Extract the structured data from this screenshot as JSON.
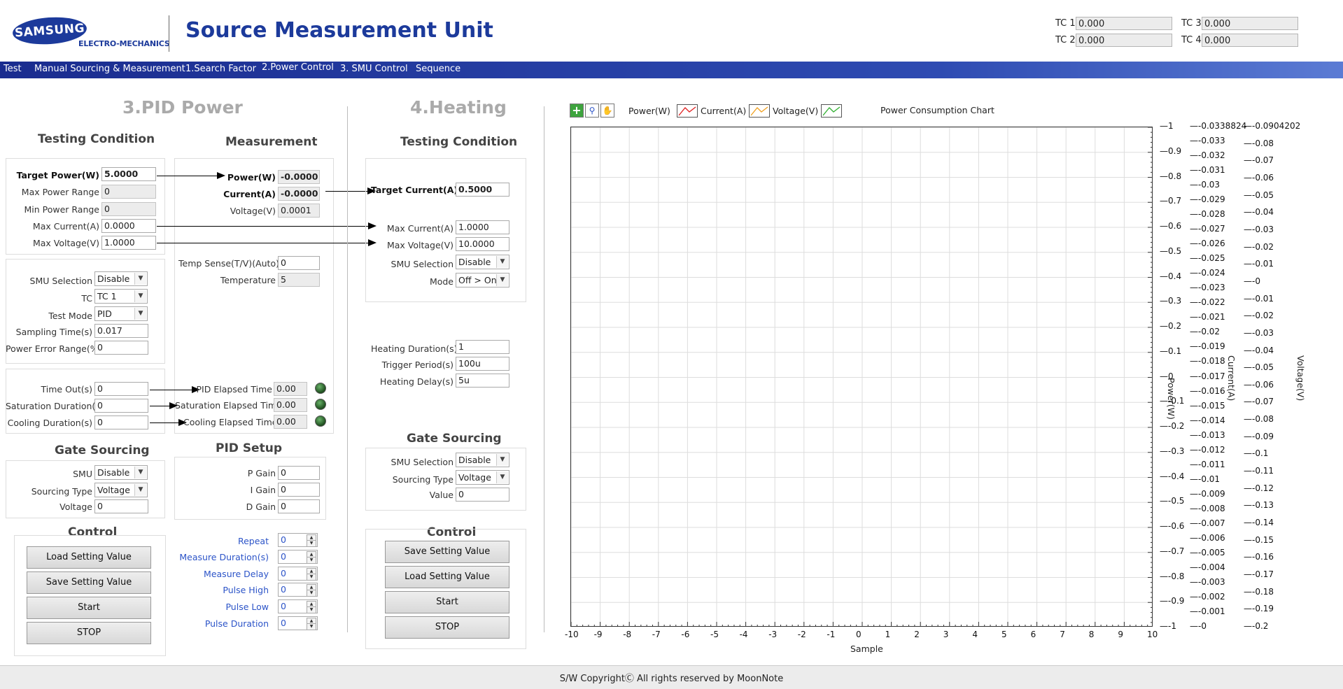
{
  "header": {
    "logo_text": "SAMSUNG",
    "logo_sub": "ELECTRO-MECHANICS",
    "title": "Source Measurement Unit",
    "tc": [
      {
        "label": "TC 1",
        "value": "0.000"
      },
      {
        "label": "TC 2",
        "value": "0.000"
      },
      {
        "label": "TC 3",
        "value": "0.000"
      },
      {
        "label": "TC 4",
        "value": "0.000"
      }
    ]
  },
  "menu": [
    "Test",
    "Manual Sourcing & Measurement",
    "1.Search Factor",
    "2.Power Control",
    "3. SMU Control",
    "Sequence"
  ],
  "pid": {
    "title": "3.PID Power",
    "testing_condition_title": "Testing Condition",
    "measurement_title": "Measurement",
    "tc_fields": [
      {
        "label": "Target Power(W)",
        "value": "5.0000"
      },
      {
        "label": "Max Power Range",
        "value": "0"
      },
      {
        "label": "Min Power Range",
        "value": "0"
      },
      {
        "label": "Max Current(A)",
        "value": "0.0000"
      },
      {
        "label": "Max Voltage(V)",
        "value": "1.0000"
      }
    ],
    "meas_fields": [
      {
        "label": "Power(W)",
        "value": "-0.0000"
      },
      {
        "label": "Current(A)",
        "value": "-0.0000"
      },
      {
        "label": "Voltage(V)",
        "value": "0.0001"
      }
    ],
    "temp_sense": {
      "label": "Temp Sense(T/V)(Auto)",
      "value": "0"
    },
    "temperature": {
      "label": "Temperature",
      "value": "5"
    },
    "smu_selection": {
      "label": "SMU Selection",
      "value": "Disable"
    },
    "tc": {
      "label": "TC",
      "value": "TC 1"
    },
    "test_mode": {
      "label": "Test Mode",
      "value": "PID"
    },
    "sampling_time": {
      "label": "Sampling Time(s)",
      "value": "0.017"
    },
    "power_error": {
      "label": "Power Error Range(%)",
      "value": "0"
    },
    "time_out": {
      "label": "Time Out(s)",
      "value": "0"
    },
    "saturation_duration": {
      "label": "Saturation Duration(s)",
      "value": "0"
    },
    "cooling_duration": {
      "label": "Cooling Duration(s)",
      "value": "0"
    },
    "pid_elapsed": {
      "label": "PID Elapsed Time",
      "value": "0.00"
    },
    "sat_elapsed": {
      "label": "Saturation Elapsed Time",
      "value": "0.00"
    },
    "cool_elapsed": {
      "label": "Cooling Elapsed Time",
      "value": "0.00"
    },
    "gate_title": "Gate Sourcing",
    "gate_smu": {
      "label": "SMU",
      "value": "Disable"
    },
    "gate_type": {
      "label": "Sourcing Type",
      "value": "Voltage"
    },
    "gate_voltage": {
      "label": "Voltage",
      "value": "0"
    },
    "pid_setup_title": "PID Setup",
    "p_gain": {
      "label": "P Gain",
      "value": "0"
    },
    "i_gain": {
      "label": "I Gain",
      "value": "0"
    },
    "d_gain": {
      "label": "D Gain",
      "value": "0"
    },
    "control_title": "Control",
    "buttons": [
      "Load Setting Value",
      "Save Setting Value",
      "Start",
      "STOP"
    ],
    "pulse": [
      {
        "label": "Repeat",
        "value": "0"
      },
      {
        "label": "Measure Duration(s)",
        "value": "0"
      },
      {
        "label": "Measure Delay",
        "value": "0"
      },
      {
        "label": "Pulse High",
        "value": "0"
      },
      {
        "label": "Pulse Low",
        "value": "0"
      },
      {
        "label": "Pulse Duration",
        "value": "0"
      }
    ]
  },
  "heating": {
    "title": "4.Heating",
    "testing_condition_title": "Testing Condition",
    "target_current": {
      "label": "Target Current(A)",
      "value": "0.5000"
    },
    "max_current": {
      "label": "Max Current(A)",
      "value": "1.0000"
    },
    "max_voltage": {
      "label": "Max Voltage(V)",
      "value": "10.0000"
    },
    "smu_selection": {
      "label": "SMU Selection",
      "value": "Disable"
    },
    "mode": {
      "label": "Mode",
      "value": "Off > On"
    },
    "heating_duration": {
      "label": "Heating Duration(s)",
      "value": "1"
    },
    "trigger_period": {
      "label": "Trigger Period(s)",
      "value": "100u"
    },
    "heating_delay": {
      "label": "Heating Delay(s)",
      "value": "5u"
    },
    "gate_title": "Gate Sourcing",
    "gate_smu": {
      "label": "SMU Selection",
      "value": "Disable"
    },
    "gate_type": {
      "label": "Sourcing Type",
      "value": "Voltage"
    },
    "gate_value": {
      "label": "Value",
      "value": "0"
    },
    "control_title": "Control",
    "buttons": [
      "Save Setting Value",
      "Load Setting Value",
      "Start",
      "STOP"
    ]
  },
  "chart_data": {
    "type": "line",
    "title": "Power Consumption Chart",
    "xlabel": "Sample",
    "x_ticks": [
      "-10",
      "-9",
      "-8",
      "-7",
      "-6",
      "-5",
      "-4",
      "-3",
      "-2",
      "-1",
      "0",
      "1",
      "2",
      "3",
      "4",
      "5",
      "6",
      "7",
      "8",
      "9",
      "10"
    ],
    "xlim": [
      -10,
      10
    ],
    "series": [
      {
        "name": "Power(W)",
        "values": [],
        "color": "#000000"
      },
      {
        "name": "Current(A)",
        "values": [],
        "color": "#e02020"
      },
      {
        "name": "Voltage(V)",
        "values": [],
        "color": "#f0a020"
      },
      {
        "name": "",
        "values": [],
        "color": "#30b030"
      }
    ],
    "axes": [
      {
        "label": "Power(W)",
        "range": [
          -1,
          1
        ],
        "ticks": [
          "1",
          "0.9",
          "0.8",
          "0.7",
          "0.6",
          "0.5",
          "0.4",
          "0.3",
          "0.2",
          "0.1",
          "0",
          "-0.1",
          "-0.2",
          "-0.3",
          "-0.4",
          "-0.5",
          "-0.6",
          "-0.7",
          "-0.8",
          "-0.9",
          "-1"
        ]
      },
      {
        "label": "Current(A)",
        "range": [
          0,
          0.0338824
        ],
        "ticks": [
          "-0.0338824",
          "-0.033",
          "-0.032",
          "-0.031",
          "-0.03",
          "-0.029",
          "-0.028",
          "-0.027",
          "-0.026",
          "-0.025",
          "-0.024",
          "-0.023",
          "-0.022",
          "-0.021",
          "-0.02",
          "-0.019",
          "-0.018",
          "-0.017",
          "-0.016",
          "-0.015",
          "-0.014",
          "-0.013",
          "-0.012",
          "-0.011",
          "-0.01",
          "-0.009",
          "-0.008",
          "-0.007",
          "-0.006",
          "-0.005",
          "-0.004",
          "-0.003",
          "-0.002",
          "-0.001",
          "-0"
        ]
      },
      {
        "label": "Voltage(V)",
        "range": [
          -0.2,
          0.0904202
        ],
        "ticks": [
          "-0.0904202",
          "-0.08",
          "-0.07",
          "-0.06",
          "-0.05",
          "-0.04",
          "-0.03",
          "-0.02",
          "-0.01",
          "-0",
          "-0.01",
          "-0.02",
          "-0.03",
          "-0.04",
          "-0.05",
          "-0.06",
          "-0.07",
          "-0.08",
          "-0.09",
          "-0.1",
          "-0.11",
          "-0.12",
          "-0.13",
          "-0.14",
          "-0.15",
          "-0.16",
          "-0.17",
          "-0.18",
          "-0.19",
          "-0.2"
        ]
      }
    ],
    "grid": true
  },
  "footer": "S/W CopyrightⒸ All rights reserved by MoonNote"
}
